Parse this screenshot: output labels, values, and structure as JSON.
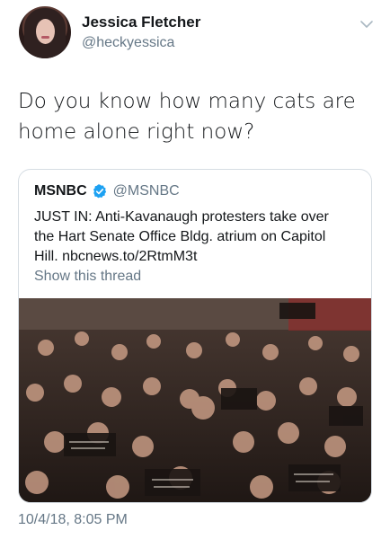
{
  "author": {
    "name": "Jessica Fletcher",
    "handle": "@heckyessica"
  },
  "tweet": {
    "text_line1": "Do you know how many cats are",
    "text_line2": "home alone right now?",
    "timestamp": "10/4/18, 8:05 PM"
  },
  "quoted_tweet": {
    "name": "MSNBC",
    "handle": "@MSNBC",
    "text_line1": "JUST IN: Anti-Kavanaugh protesters take over",
    "text_line2": "the Hart Senate Office Bldg. atrium on Capitol",
    "text_line3": "Hill. nbcnews.to/2RtmM3t",
    "show_thread": "Show this thread",
    "image_description_icon": "protest-crowd-photo"
  },
  "colors": {
    "text": "#14171a",
    "secondary": "#657786",
    "verified": "#1da1f2",
    "border": "#d6dde3"
  },
  "icons": {
    "caret": "chevron-down-icon",
    "verified": "verified-badge-icon"
  }
}
